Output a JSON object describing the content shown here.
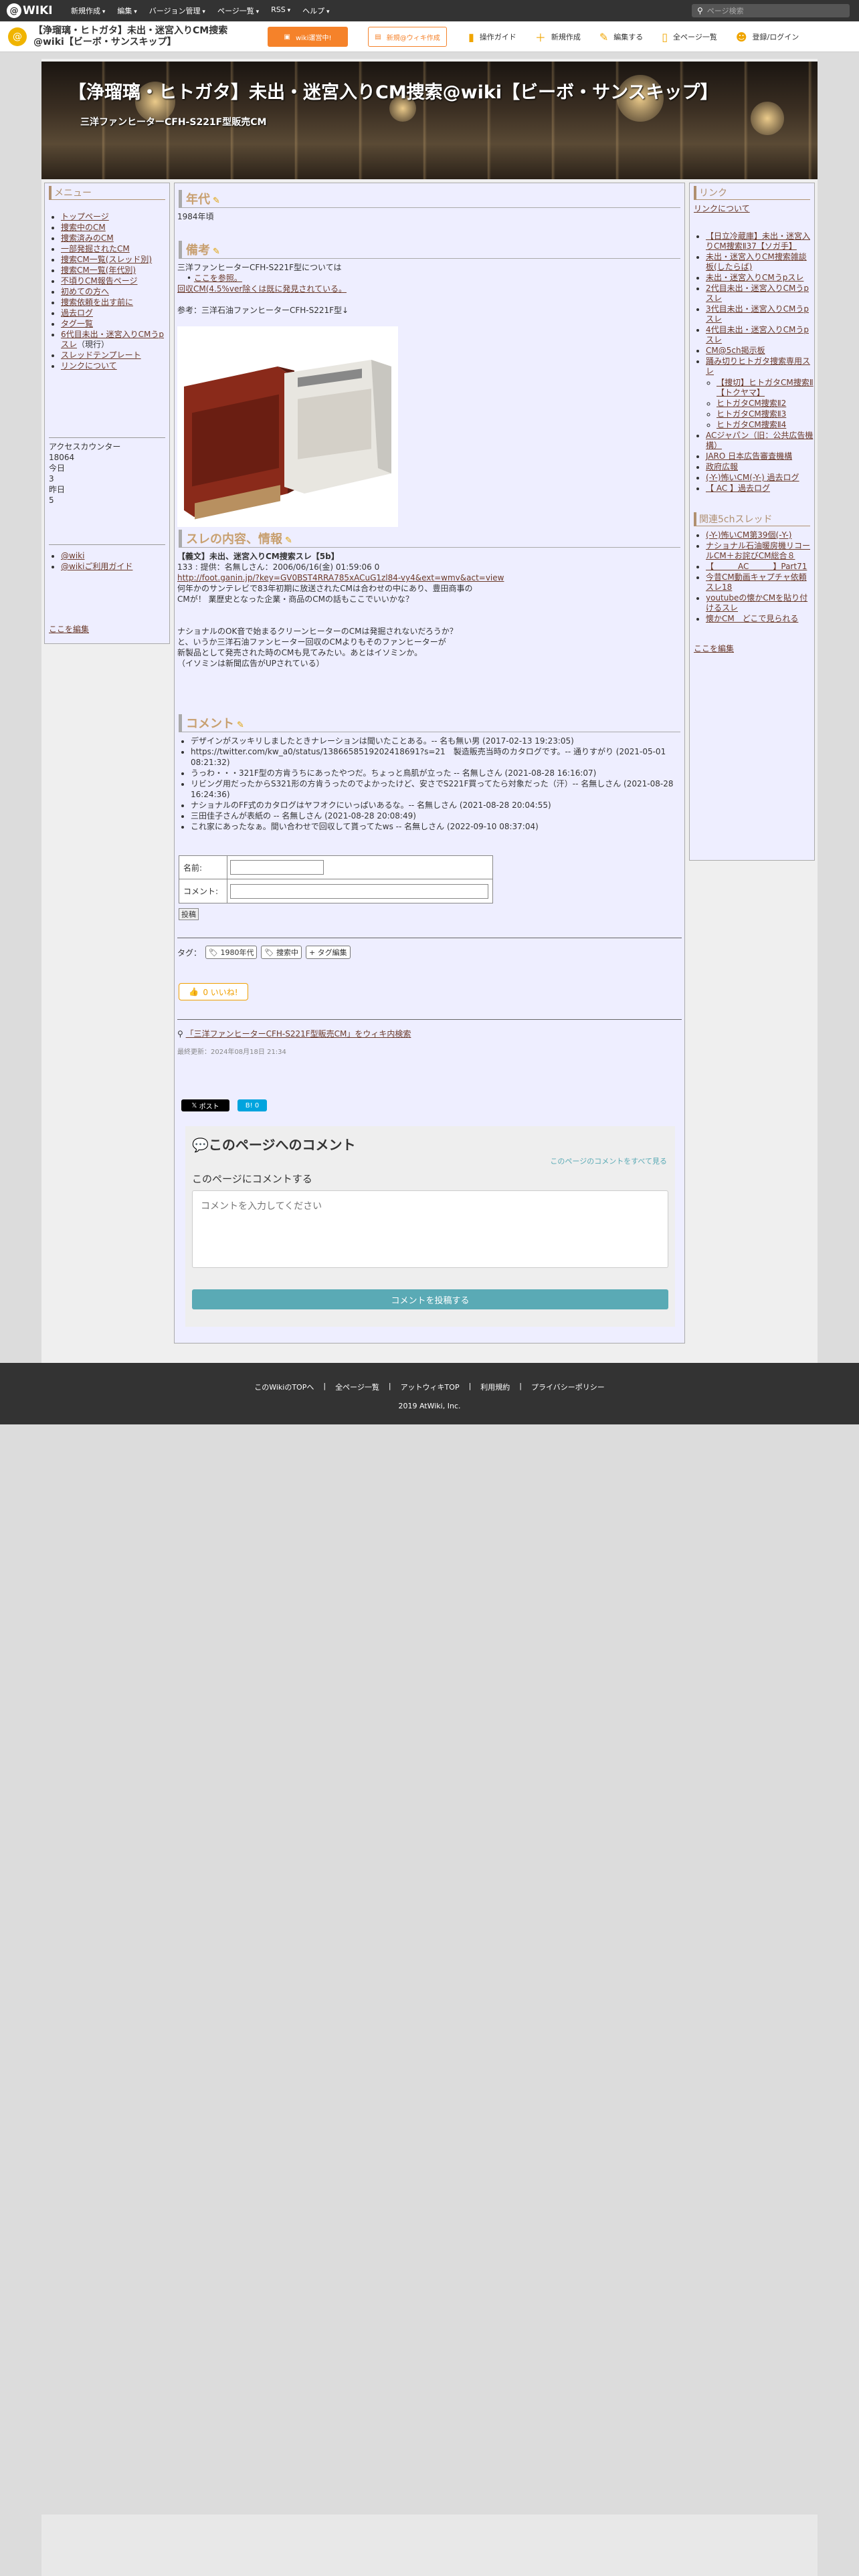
{
  "topbar": {
    "logo": "WIKI",
    "menus": [
      "新規作成",
      "編集",
      "バージョン管理",
      "ページ一覧",
      "RSS",
      "ヘルプ"
    ],
    "search_placeholder": "ページ検索"
  },
  "subbar": {
    "title_line1": "【浄瑠璃・ヒトガタ】未出・迷宮入りCM捜索",
    "title_line2": "@wiki【ビーボ・サンスキップ】",
    "btn_orange": "wiki運営中!",
    "btn_outline": "新規@ウィキ作成",
    "tools": [
      {
        "icon": "guide-icon",
        "label": "操作ガイド"
      },
      {
        "icon": "plus-icon",
        "label": "新規作成"
      },
      {
        "icon": "pencil-icon",
        "label": "編集する"
      },
      {
        "icon": "page-icon",
        "label": "全ページ一覧"
      },
      {
        "icon": "user-icon",
        "label": "登録/ログイン"
      }
    ]
  },
  "banner": {
    "title": "【浄瑠璃・ヒトガタ】未出・迷宮入りCM捜索@wiki【ビーボ・サンスキップ】",
    "subtitle": "三洋ファンヒーターCFH-S221F型販売CM"
  },
  "left": {
    "heading": "メニュー",
    "items": [
      "トップページ",
      "捜索中のCM",
      "捜索済みのCM",
      "一部発掘されたCM",
      "捜索CM一覧(スレッド別)",
      "捜索CM一覧(年代別)",
      "不頃りCM報告ページ",
      "初めての方へ",
      "捜索依頼を出す前に",
      "過去ログ",
      "タグ一覧",
      "6代目未出・迷宮入りCMうpスレ",
      "スレッドテンプレート",
      "リンクについて"
    ],
    "item_suffix": "（現行）",
    "counter_label": "アクセスカウンター",
    "counter": "18064",
    "today_label": "今日",
    "today": "3",
    "yesterday_label": "昨日",
    "yesterday": "5",
    "links": [
      "@wiki",
      "@wikiご利用ガイド"
    ],
    "edit": "ここを編集"
  },
  "right": {
    "heading": "リンク",
    "about": "リンクについて",
    "items": [
      "【日立冷蔵庫】未出・迷宮入りCM捜索Ⅱ37【ソガ手】",
      "未出・迷宮入りCM捜索雑談板(したらば)",
      "未出・迷宮入りCMうpスレ",
      "2代目未出・迷宮入りCMうpスレ",
      "3代目未出・迷宮入りCMうpスレ",
      "4代目未出・迷宮入りCMうpスレ",
      "CM@5ch掲示板",
      "踊み切りヒトガタ捜索専用スレ"
    ],
    "subitems": [
      "【捜切】ヒトガタCM捜索Ⅱ【トクヤマ】",
      "ヒトガタCM捜索Ⅱ2",
      "ヒトガタCM捜索Ⅱ3",
      "ヒトガタCM捜索Ⅱ4"
    ],
    "items2": [
      "ACジャパン（旧：公共広告機構）",
      "JARO 日本広告審査機構",
      "政府広報",
      "(-Y-)怖いCM(-Y-) 過去ログ",
      "【 AC 】過去ログ"
    ],
    "heading2": "関連5chスレッド",
    "items3": [
      "(-Y-)怖いCM第39個(-Y-)",
      "ナショナル石油暖房機リコールCM＋お詫びCM総合８",
      "【　　　AC　　　】Part71",
      "今昔CM動画キャプチャ依頼スレ18",
      "youtubeの懐かCMを貼り付けるスレ",
      "懐かCM　どこで見られる"
    ],
    "edit": "ここを編集"
  },
  "main": {
    "sec1": "年代",
    "sec1_text": "1984年頃",
    "sec2": "備考",
    "sec2_lines": [
      "三洋ファンヒーターCFH-S221F型については",
      "ここを参照。",
      "回収CM(4.5%ver除くは既に発見されている。",
      "",
      "参考：三洋石油ファンヒーターCFH-S221F型↓"
    ],
    "sec3": "スレの内容、情報",
    "sec3_lines": [
      "【義文】未出、迷宮入りCM捜索スレ【5b】",
      "133 : 提供：名無しさん：2006/06/16(金) 01:59:06 0",
      "http://foot.ganin.jp/?key=GV0BST4RRA785xACuG1zl84-vy4&ext=wmv&act=view",
      "何年かのサンテレビで83年初期に放送されたCMは合わせの中にあり、豊田商事の",
      "CMが！ 業歴史となった企業・商品のCMの話もここでいいかな？",
      "",
      "",
      "ナショナルのOK音で始まるクリーンヒーターのCMは発掘されないだろうか？",
      "と、いうか三洋石油ファンヒーター回収のCMよりもそのファンヒーターが",
      "新製品として発売された時のCMも見てみたい。あとはイソミンか。",
      "（イソミンは新聞広告がUPされている）"
    ],
    "sec4": "コメント",
    "comments": [
      "デザインがスッキリしましたときナレーションは聞いたことある。-- 名も無い男 (2017-02-13 19:23:05)",
      "https://twitter.com/kw_a0/status/1386658519202418691?s=21　製造販売当時のカタログです。-- 通りすがり (2021-05-01 08:21:32)",
      "うっわ・・・321F型の方肯うちにあったやつだ。ちょっと鳥肌が立った -- 名無しさん (2021-08-28 16:16:07)",
      "リビング用だったからS321形の方肯うったのでよかったけど、安さでS221F買ってたら対象だった（汗）-- 名無しさん (2021-08-28 16:24:36)",
      "ナショナルのFF式のカタログはヤフオクにいっぱいあるな。-- 名無しさん (2021-08-28 20:04:55)",
      "三田佳子さんが表紙の -- 名無しさん (2021-08-28 20:08:49)",
      "これ家にあったなぁ。間い合わせで回収して貰ってたws -- 名無しさん (2022-09-10 08:37:04)"
    ],
    "name_label": "名前:",
    "comment_label": "コメント:",
    "post_label": "投稿",
    "tag_label": "タグ：",
    "tags": [
      "1980年代",
      "捜索中",
      "+ タグ編集"
    ],
    "like": "0 いいね!",
    "wiki_search": "「三洋ファンヒーターCFH-S221F型販売CM」をウィキ内検索",
    "updated": "最終更新：2024年08月18日 21:34",
    "x_post": "ポスト",
    "hatena": "B! 0",
    "cbox_title": "このページへのコメント",
    "cbox_all": "このページのコメントをすべて見る",
    "cbox_label": "このページにコメントする",
    "cbox_placeholder": "コメントを入力してください",
    "cbox_submit": "コメントを投稿する"
  },
  "footer": {
    "links": [
      "このWikiのTOPへ",
      "全ページ一覧",
      "アットウィキTOP",
      "利用規約",
      "プライバシーポリシー"
    ],
    "copy": "2019 AtWiki, Inc."
  },
  "colors": {
    "accent": "#f5822a",
    "link": "#6b3a2a",
    "heading": "#c8a070",
    "panel": "#eeeeff"
  }
}
